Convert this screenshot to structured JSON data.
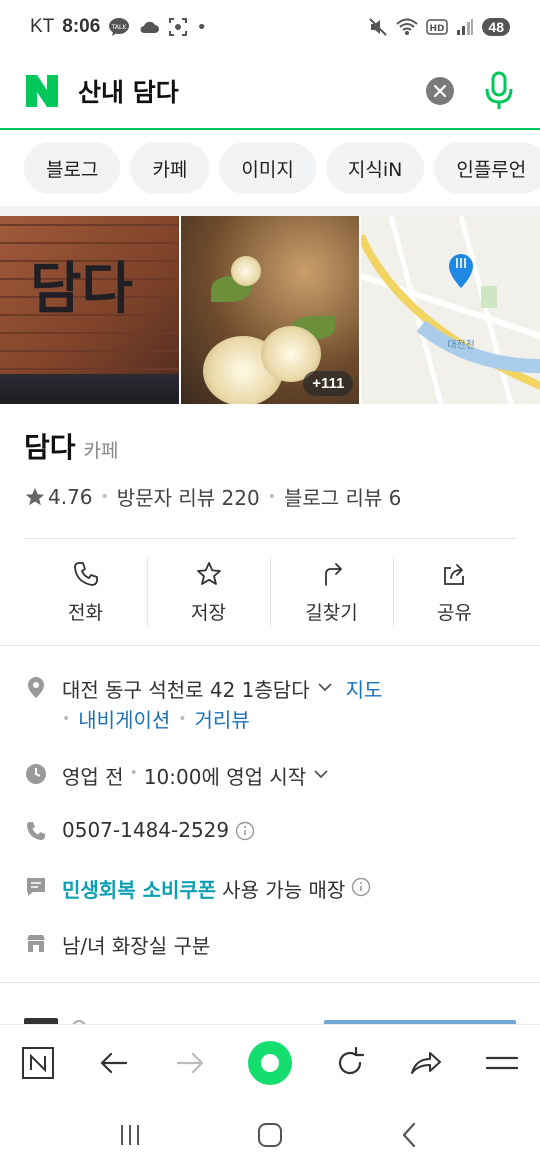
{
  "status_bar": {
    "carrier": "KT",
    "time": "8:06",
    "battery": "48",
    "left_icons": [
      "talk-icon",
      "cloud-icon",
      "screenshot-icon",
      "dot-icon"
    ],
    "right_icons": [
      "mute-icon",
      "wifi-icon",
      "hd-icon",
      "signal-icon"
    ]
  },
  "search": {
    "query": "산내 담다",
    "logo": "N"
  },
  "tabs": [
    "블로그",
    "카페",
    "이미지",
    "지식iN",
    "인플루언"
  ],
  "photos": {
    "more_count": "+111",
    "map_label": "대전천",
    "sign_text": "담다"
  },
  "place": {
    "name": "담다",
    "category": "카페",
    "rating": "4.76",
    "visitor_reviews": "방문자 리뷰 220",
    "blog_reviews": "블로그 리뷰 6"
  },
  "actions": [
    {
      "label": "전화",
      "icon": "phone-icon"
    },
    {
      "label": "저장",
      "icon": "star-icon"
    },
    {
      "label": "길찾기",
      "icon": "directions-icon"
    },
    {
      "label": "공유",
      "icon": "share-icon"
    }
  ],
  "details": {
    "address": "대전 동구 석천로 42 1층담다",
    "map_link": "지도",
    "navigation_link": "내비게이션",
    "street_view_link": "거리뷰",
    "hours_status": "영업 전",
    "hours_text": "10:00에 영업 시작",
    "phone": "0507-1484-2529",
    "coupon_highlight": "민생회복 소비쿠폰",
    "coupon_text": "사용 가능 매장",
    "restroom": "남/녀 화장실 구분"
  },
  "colors": {
    "naver_green": "#03c75a",
    "link_blue": "#1a73b9",
    "coupon_teal": "#0e9fb5",
    "map_pin": "#1e88e5"
  }
}
